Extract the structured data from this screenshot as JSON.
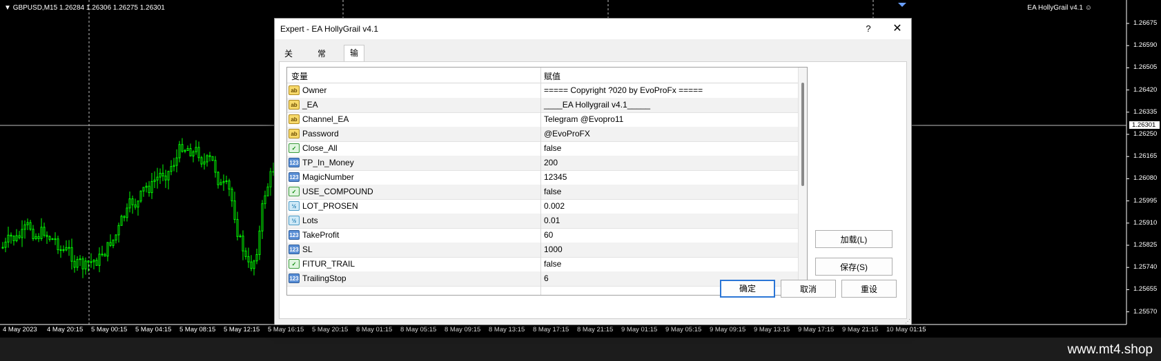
{
  "chart": {
    "symbol_label": "GBPUSD,M15  1.26284 1.26306 1.26275 1.26301",
    "ea_label": "EA HollyGrail v4.1",
    "price_ticks": [
      "1.26675",
      "1.26590",
      "1.26505",
      "1.26420",
      "1.26335",
      "1.26250",
      "1.26165",
      "1.26080",
      "1.25995",
      "1.25910",
      "1.25825",
      "1.25740",
      "1.25655",
      "1.25570"
    ],
    "current_price": "1.26301",
    "time_ticks": [
      "4 May 2023",
      "4 May 20:15",
      "5 May 00:15",
      "5 May 04:15",
      "5 May 08:15",
      "5 May 12:15",
      "5 May 16:15",
      "5 May 20:15",
      "8 May 01:15",
      "8 May 05:15",
      "8 May 09:15",
      "8 May 13:15",
      "8 May 17:15",
      "8 May 21:15",
      "9 May 01:15",
      "9 May 05:15",
      "9 May 09:15",
      "9 May 13:15",
      "9 May 17:15",
      "9 May 21:15",
      "10 May 01:15"
    ],
    "candle_color": "#00ff00",
    "watermark": "www.mt4.shop"
  },
  "dialog": {
    "title": "Expert - EA HollyGrail v4.1",
    "help_glyph": "?",
    "close_glyph": "✕",
    "tabs": [
      {
        "label": "关于",
        "active": false
      },
      {
        "label": "常用",
        "active": false
      },
      {
        "label": "输入参数",
        "active": true
      }
    ],
    "grid": {
      "col_variable": "变量",
      "col_value": "赋值",
      "rows": [
        {
          "icon": "ab",
          "name": "Owner",
          "value": "===== Copyright ?020 by EvoProFx ====="
        },
        {
          "icon": "ab",
          "name": "_EA",
          "value": "____EA Hollygrail v4.1_____"
        },
        {
          "icon": "ab",
          "name": "Channel_EA",
          "value": "Telegram @Evopro11"
        },
        {
          "icon": "ab",
          "name": "Password",
          "value": "@EvoProFX"
        },
        {
          "icon": "bool",
          "name": "Close_All",
          "value": "false"
        },
        {
          "icon": "int",
          "name": "TP_In_Money",
          "value": "200"
        },
        {
          "icon": "int",
          "name": "MagicNumber",
          "value": "12345"
        },
        {
          "icon": "bool",
          "name": "USE_COMPOUND",
          "value": "false"
        },
        {
          "icon": "dbl",
          "name": "LOT_PROSEN",
          "value": "0.002"
        },
        {
          "icon": "dbl",
          "name": "Lots",
          "value": "0.01"
        },
        {
          "icon": "int",
          "name": "TakeProfit",
          "value": "60"
        },
        {
          "icon": "int",
          "name": "SL",
          "value": "1000"
        },
        {
          "icon": "bool",
          "name": "FITUR_TRAIL",
          "value": "false"
        },
        {
          "icon": "int",
          "name": "TrailingStop",
          "value": "6"
        }
      ]
    },
    "buttons": {
      "load": "加载(L)",
      "save": "保存(S)",
      "ok": "确定",
      "cancel": "取消",
      "reset": "重设"
    }
  }
}
